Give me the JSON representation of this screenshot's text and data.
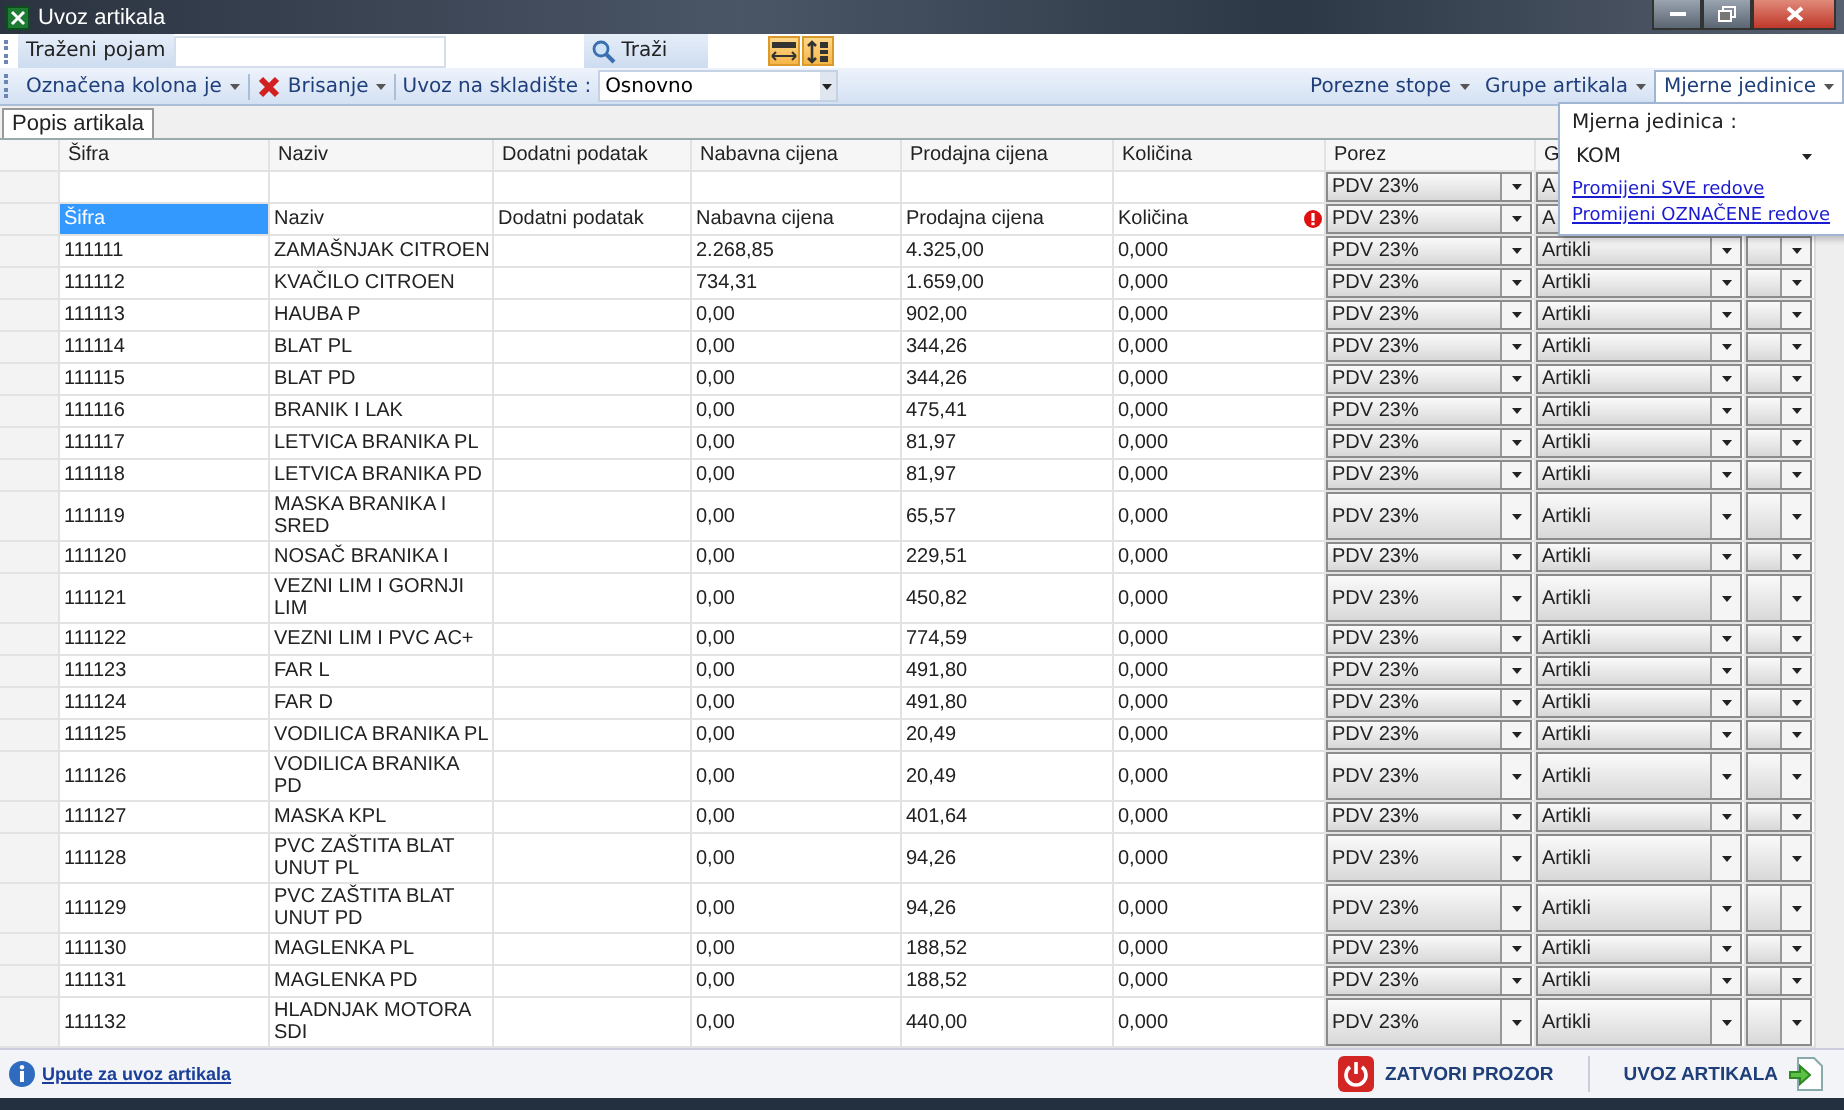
{
  "window": {
    "title": "Uvoz artikala"
  },
  "search_bar": {
    "label": "Traženi pojam",
    "button": "Traži",
    "toggles": [
      {
        "kind": "auto-width",
        "on": true
      },
      {
        "kind": "sort",
        "on": true
      }
    ]
  },
  "toolbar": {
    "column_menu": "Označena kolona je",
    "delete_menu": "Brisanje",
    "warehouse_label": "Uvoz na skladište :",
    "warehouse_value": "Osnovno",
    "menus": [
      {
        "label": "Porezne stope",
        "open": false
      },
      {
        "label": "Grupe artikala",
        "open": false
      },
      {
        "label": "Mjerne jedinice",
        "open": true
      }
    ]
  },
  "popup": {
    "label": "Mjerna jedinica :",
    "value": "KOM",
    "links": [
      "Promijeni SVE redove",
      "Promijeni OZNAČENE redove"
    ]
  },
  "tabs": [
    {
      "label": "Popis artikala",
      "selected": true
    }
  ],
  "table": {
    "columns": [
      "Šifra",
      "Naziv",
      "Dodatni podatak",
      "Nabavna cijena",
      "Prodajna cijena",
      "Količina",
      "Porez",
      "G"
    ],
    "filter_row": {
      "porez": "PDV 23%",
      "column_7": "A"
    },
    "editor_row": {
      "cells": [
        {
          "text": "Šifra",
          "selected": true
        },
        {
          "text": "Naziv",
          "selected": false
        },
        {
          "text": "Dodatni podatak",
          "selected": false
        },
        {
          "text": "Nabavna cijena",
          "selected": false
        },
        {
          "text": "Prodajna cijena",
          "selected": false
        },
        {
          "text": "Količina",
          "selected": false
        }
      ],
      "error": true,
      "porez": "PDV 23%",
      "column_7": "A"
    },
    "rows": [
      {
        "sifra": "111111",
        "naziv": "ZAMAŠNJAK CITROEN",
        "nabavna": "2.268,85",
        "prodajna": "4.325,00",
        "kolicina": "0,000",
        "porez": "PDV 23%",
        "grupa": "Artikli"
      },
      {
        "sifra": "111112",
        "naziv": "KVAČILO CITROEN",
        "nabavna": "734,31",
        "prodajna": "1.659,00",
        "kolicina": "0,000",
        "porez": "PDV 23%",
        "grupa": "Artikli"
      },
      {
        "sifra": "111113",
        "naziv": "HAUBA P",
        "nabavna": "0,00",
        "prodajna": "902,00",
        "kolicina": "0,000",
        "porez": "PDV 23%",
        "grupa": "Artikli"
      },
      {
        "sifra": "111114",
        "naziv": "BLAT PL",
        "nabavna": "0,00",
        "prodajna": "344,26",
        "kolicina": "0,000",
        "porez": "PDV 23%",
        "grupa": "Artikli"
      },
      {
        "sifra": "111115",
        "naziv": "BLAT PD",
        "nabavna": "0,00",
        "prodajna": "344,26",
        "kolicina": "0,000",
        "porez": "PDV 23%",
        "grupa": "Artikli"
      },
      {
        "sifra": "111116",
        "naziv": "BRANIK I LAK",
        "nabavna": "0,00",
        "prodajna": "475,41",
        "kolicina": "0,000",
        "porez": "PDV 23%",
        "grupa": "Artikli"
      },
      {
        "sifra": "111117",
        "naziv": "LETVICA BRANIKA PL",
        "nabavna": "0,00",
        "prodajna": "81,97",
        "kolicina": "0,000",
        "porez": "PDV 23%",
        "grupa": "Artikli"
      },
      {
        "sifra": "111118",
        "naziv": "LETVICA BRANIKA PD",
        "nabavna": "0,00",
        "prodajna": "81,97",
        "kolicina": "0,000",
        "porez": "PDV 23%",
        "grupa": "Artikli"
      },
      {
        "sifra": "111119",
        "naziv": "MASKA BRANIKA I SRED",
        "nabavna": "0,00",
        "prodajna": "65,57",
        "kolicina": "0,000",
        "porez": "PDV 23%",
        "grupa": "Artikli"
      },
      {
        "sifra": "111120",
        "naziv": "NOSAČ BRANIKA I",
        "nabavna": "0,00",
        "prodajna": "229,51",
        "kolicina": "0,000",
        "porez": "PDV 23%",
        "grupa": "Artikli"
      },
      {
        "sifra": "111121",
        "naziv": "VEZNI LIM I GORNJI LIM",
        "nabavna": "0,00",
        "prodajna": "450,82",
        "kolicina": "0,000",
        "porez": "PDV 23%",
        "grupa": "Artikli"
      },
      {
        "sifra": "111122",
        "naziv": "VEZNI LIM I PVC AC+",
        "nabavna": "0,00",
        "prodajna": "774,59",
        "kolicina": "0,000",
        "porez": "PDV 23%",
        "grupa": "Artikli"
      },
      {
        "sifra": "111123",
        "naziv": "FAR L",
        "nabavna": "0,00",
        "prodajna": "491,80",
        "kolicina": "0,000",
        "porez": "PDV 23%",
        "grupa": "Artikli"
      },
      {
        "sifra": "111124",
        "naziv": "FAR D",
        "nabavna": "0,00",
        "prodajna": "491,80",
        "kolicina": "0,000",
        "porez": "PDV 23%",
        "grupa": "Artikli"
      },
      {
        "sifra": "111125",
        "naziv": "VODILICA BRANIKA PL",
        "nabavna": "0,00",
        "prodajna": "20,49",
        "kolicina": "0,000",
        "porez": "PDV 23%",
        "grupa": "Artikli"
      },
      {
        "sifra": "111126",
        "naziv": "VODILICA BRANIKA PD",
        "nabavna": "0,00",
        "prodajna": "20,49",
        "kolicina": "0,000",
        "porez": "PDV 23%",
        "grupa": "Artikli"
      },
      {
        "sifra": "111127",
        "naziv": "MASKA KPL",
        "nabavna": "0,00",
        "prodajna": "401,64",
        "kolicina": "0,000",
        "porez": "PDV 23%",
        "grupa": "Artikli"
      },
      {
        "sifra": "111128",
        "naziv": "PVC ZAŠTITA BLAT UNUT PL",
        "nabavna": "0,00",
        "prodajna": "94,26",
        "kolicina": "0,000",
        "porez": "PDV 23%",
        "grupa": "Artikli"
      },
      {
        "sifra": "111129",
        "naziv": "PVC ZAŠTITA BLAT UNUT PD",
        "nabavna": "0,00",
        "prodajna": "94,26",
        "kolicina": "0,000",
        "porez": "PDV 23%",
        "grupa": "Artikli"
      },
      {
        "sifra": "111130",
        "naziv": "MAGLENKA PL",
        "nabavna": "0,00",
        "prodajna": "188,52",
        "kolicina": "0,000",
        "porez": "PDV 23%",
        "grupa": "Artikli"
      },
      {
        "sifra": "111131",
        "naziv": "MAGLENKA PD",
        "nabavna": "0,00",
        "prodajna": "188,52",
        "kolicina": "0,000",
        "porez": "PDV 23%",
        "grupa": "Artikli"
      },
      {
        "sifra": "111132",
        "naziv": "HLADNJAK MOTORA SDI",
        "nabavna": "0,00",
        "prodajna": "440,00",
        "kolicina": "0,000",
        "porez": "PDV 23%",
        "grupa": "Artikli"
      }
    ]
  },
  "footer": {
    "help_link": "Upute za uvoz artikala",
    "close_button": "ZATVORI PROZOR",
    "import_button": "UVOZ ARTIKALA"
  }
}
